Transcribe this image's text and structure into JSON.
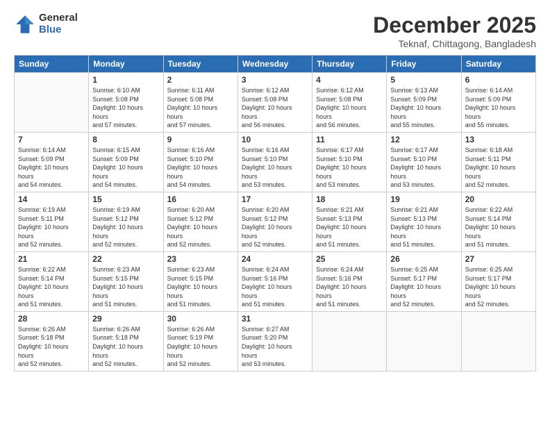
{
  "logo": {
    "general": "General",
    "blue": "Blue"
  },
  "header": {
    "title": "December 2025",
    "subtitle": "Teknaf, Chittagong, Bangladesh"
  },
  "weekdays": [
    "Sunday",
    "Monday",
    "Tuesday",
    "Wednesday",
    "Thursday",
    "Friday",
    "Saturday"
  ],
  "weeks": [
    [
      {
        "day": "",
        "empty": true
      },
      {
        "day": "1",
        "sunrise": "Sunrise: 6:10 AM",
        "sunset": "Sunset: 5:08 PM",
        "daylight": "Daylight: 10 hours and 57 minutes."
      },
      {
        "day": "2",
        "sunrise": "Sunrise: 6:11 AM",
        "sunset": "Sunset: 5:08 PM",
        "daylight": "Daylight: 10 hours and 57 minutes."
      },
      {
        "day": "3",
        "sunrise": "Sunrise: 6:12 AM",
        "sunset": "Sunset: 5:08 PM",
        "daylight": "Daylight: 10 hours and 56 minutes."
      },
      {
        "day": "4",
        "sunrise": "Sunrise: 6:12 AM",
        "sunset": "Sunset: 5:08 PM",
        "daylight": "Daylight: 10 hours and 56 minutes."
      },
      {
        "day": "5",
        "sunrise": "Sunrise: 6:13 AM",
        "sunset": "Sunset: 5:09 PM",
        "daylight": "Daylight: 10 hours and 55 minutes."
      },
      {
        "day": "6",
        "sunrise": "Sunrise: 6:14 AM",
        "sunset": "Sunset: 5:09 PM",
        "daylight": "Daylight: 10 hours and 55 minutes."
      }
    ],
    [
      {
        "day": "7",
        "sunrise": "Sunrise: 6:14 AM",
        "sunset": "Sunset: 5:09 PM",
        "daylight": "Daylight: 10 hours and 54 minutes."
      },
      {
        "day": "8",
        "sunrise": "Sunrise: 6:15 AM",
        "sunset": "Sunset: 5:09 PM",
        "daylight": "Daylight: 10 hours and 54 minutes."
      },
      {
        "day": "9",
        "sunrise": "Sunrise: 6:16 AM",
        "sunset": "Sunset: 5:10 PM",
        "daylight": "Daylight: 10 hours and 54 minutes."
      },
      {
        "day": "10",
        "sunrise": "Sunrise: 6:16 AM",
        "sunset": "Sunset: 5:10 PM",
        "daylight": "Daylight: 10 hours and 53 minutes."
      },
      {
        "day": "11",
        "sunrise": "Sunrise: 6:17 AM",
        "sunset": "Sunset: 5:10 PM",
        "daylight": "Daylight: 10 hours and 53 minutes."
      },
      {
        "day": "12",
        "sunrise": "Sunrise: 6:17 AM",
        "sunset": "Sunset: 5:10 PM",
        "daylight": "Daylight: 10 hours and 53 minutes."
      },
      {
        "day": "13",
        "sunrise": "Sunrise: 6:18 AM",
        "sunset": "Sunset: 5:11 PM",
        "daylight": "Daylight: 10 hours and 52 minutes."
      }
    ],
    [
      {
        "day": "14",
        "sunrise": "Sunrise: 6:19 AM",
        "sunset": "Sunset: 5:11 PM",
        "daylight": "Daylight: 10 hours and 52 minutes."
      },
      {
        "day": "15",
        "sunrise": "Sunrise: 6:19 AM",
        "sunset": "Sunset: 5:12 PM",
        "daylight": "Daylight: 10 hours and 52 minutes."
      },
      {
        "day": "16",
        "sunrise": "Sunrise: 6:20 AM",
        "sunset": "Sunset: 5:12 PM",
        "daylight": "Daylight: 10 hours and 52 minutes."
      },
      {
        "day": "17",
        "sunrise": "Sunrise: 6:20 AM",
        "sunset": "Sunset: 5:12 PM",
        "daylight": "Daylight: 10 hours and 52 minutes."
      },
      {
        "day": "18",
        "sunrise": "Sunrise: 6:21 AM",
        "sunset": "Sunset: 5:13 PM",
        "daylight": "Daylight: 10 hours and 51 minutes."
      },
      {
        "day": "19",
        "sunrise": "Sunrise: 6:21 AM",
        "sunset": "Sunset: 5:13 PM",
        "daylight": "Daylight: 10 hours and 51 minutes."
      },
      {
        "day": "20",
        "sunrise": "Sunrise: 6:22 AM",
        "sunset": "Sunset: 5:14 PM",
        "daylight": "Daylight: 10 hours and 51 minutes."
      }
    ],
    [
      {
        "day": "21",
        "sunrise": "Sunrise: 6:22 AM",
        "sunset": "Sunset: 5:14 PM",
        "daylight": "Daylight: 10 hours and 51 minutes."
      },
      {
        "day": "22",
        "sunrise": "Sunrise: 6:23 AM",
        "sunset": "Sunset: 5:15 PM",
        "daylight": "Daylight: 10 hours and 51 minutes."
      },
      {
        "day": "23",
        "sunrise": "Sunrise: 6:23 AM",
        "sunset": "Sunset: 5:15 PM",
        "daylight": "Daylight: 10 hours and 51 minutes."
      },
      {
        "day": "24",
        "sunrise": "Sunrise: 6:24 AM",
        "sunset": "Sunset: 5:16 PM",
        "daylight": "Daylight: 10 hours and 51 minutes."
      },
      {
        "day": "25",
        "sunrise": "Sunrise: 6:24 AM",
        "sunset": "Sunset: 5:16 PM",
        "daylight": "Daylight: 10 hours and 51 minutes."
      },
      {
        "day": "26",
        "sunrise": "Sunrise: 6:25 AM",
        "sunset": "Sunset: 5:17 PM",
        "daylight": "Daylight: 10 hours and 52 minutes."
      },
      {
        "day": "27",
        "sunrise": "Sunrise: 6:25 AM",
        "sunset": "Sunset: 5:17 PM",
        "daylight": "Daylight: 10 hours and 52 minutes."
      }
    ],
    [
      {
        "day": "28",
        "sunrise": "Sunrise: 6:26 AM",
        "sunset": "Sunset: 5:18 PM",
        "daylight": "Daylight: 10 hours and 52 minutes."
      },
      {
        "day": "29",
        "sunrise": "Sunrise: 6:26 AM",
        "sunset": "Sunset: 5:18 PM",
        "daylight": "Daylight: 10 hours and 52 minutes."
      },
      {
        "day": "30",
        "sunrise": "Sunrise: 6:26 AM",
        "sunset": "Sunset: 5:19 PM",
        "daylight": "Daylight: 10 hours and 52 minutes."
      },
      {
        "day": "31",
        "sunrise": "Sunrise: 6:27 AM",
        "sunset": "Sunset: 5:20 PM",
        "daylight": "Daylight: 10 hours and 53 minutes."
      },
      {
        "day": "",
        "empty": true
      },
      {
        "day": "",
        "empty": true
      },
      {
        "day": "",
        "empty": true
      }
    ]
  ]
}
